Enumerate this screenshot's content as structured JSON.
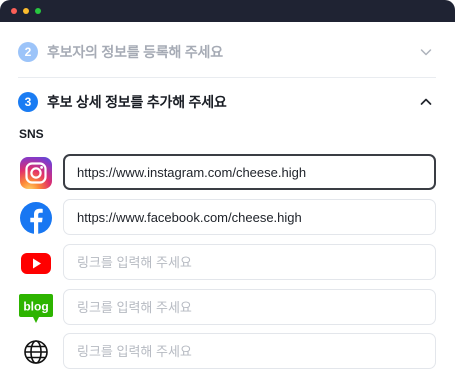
{
  "window": {
    "colors": {
      "titlebar": "#1f2333",
      "close": "#fc5f57",
      "minimize": "#fcbc2e",
      "maximize": "#28c840"
    }
  },
  "steps": [
    {
      "number": "2",
      "title": "후보자의 정보를 등록해 주세요",
      "state": "collapsed",
      "chevron": "chevron-down-icon"
    },
    {
      "number": "3",
      "title": "후보 상세 정보를 추가해 주세요",
      "state": "expanded",
      "chevron": "chevron-up-icon"
    }
  ],
  "sns": {
    "label": "SNS",
    "rows": [
      {
        "icon": "instagram-icon",
        "value": "https://www.instagram.com/cheese.high",
        "placeholder": "링크를 입력해 주세요",
        "focused": true
      },
      {
        "icon": "facebook-icon",
        "value": "https://www.facebook.com/cheese.high",
        "placeholder": "링크를 입력해 주세요",
        "focused": false
      },
      {
        "icon": "youtube-icon",
        "value": "",
        "placeholder": "링크를 입력해 주세요",
        "focused": false
      },
      {
        "icon": "blog-icon",
        "value": "",
        "placeholder": "링크를 입력해 주세요",
        "focused": false,
        "icon_text": "blog"
      },
      {
        "icon": "globe-icon",
        "value": "",
        "placeholder": "링크를 입력해 주세요",
        "focused": false
      }
    ]
  },
  "accent": "#1a7cf3"
}
